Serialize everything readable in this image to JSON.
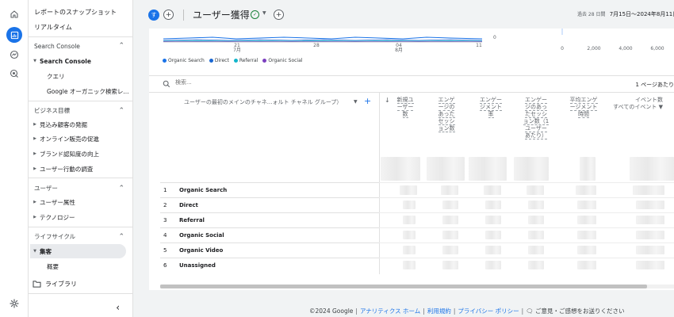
{
  "rail": {
    "items": [
      {
        "name": "home-icon"
      },
      {
        "name": "reports-icon",
        "active": true
      },
      {
        "name": "explore-icon"
      },
      {
        "name": "advertising-icon"
      },
      {
        "name": "settings-icon"
      }
    ]
  },
  "sidebar": {
    "top": [
      "レポートのスナップショット",
      "リアルタイム"
    ],
    "sections": [
      {
        "title": "Search Console",
        "items": [
          {
            "label": "Search Console",
            "bold": true,
            "expanded": true
          }
        ],
        "subitems": [
          "クエリ",
          "Google オーガニック検索レ..."
        ]
      },
      {
        "title": "ビジネス目標",
        "items": [
          {
            "label": "見込み顧客の発掘"
          },
          {
            "label": "オンライン販売の促進"
          },
          {
            "label": "ブランド認知度の向上"
          },
          {
            "label": "ユーザー行動の調査"
          }
        ]
      },
      {
        "title": "ユーザー",
        "items": [
          {
            "label": "ユーザー属性"
          },
          {
            "label": "テクノロジー"
          }
        ]
      },
      {
        "title": "ライフサイクル",
        "items": [
          {
            "label": "集客",
            "bold": true,
            "expanded": true,
            "selected": true
          }
        ],
        "subitems": [
          "概要"
        ]
      }
    ],
    "library": "ライブラリ",
    "collapse_icon": "chevron-left-icon"
  },
  "header": {
    "avatar_letter": "す",
    "title": "ユーザー獲得",
    "date_label": "過去 28 日間",
    "date_range": "7月15日～2024年8月11日"
  },
  "chart_data": {
    "type": "line",
    "x_ticks": [
      {
        "label": "21",
        "sub": "7月"
      },
      {
        "label": "28",
        "sub": ""
      },
      {
        "label": "04",
        "sub": "8月"
      },
      {
        "label": "11",
        "sub": ""
      }
    ],
    "y_tick_right": "0",
    "bar_axis_ticks": [
      "0",
      "2,000",
      "4,000",
      "6,000"
    ],
    "series": [
      {
        "name": "Organic Search",
        "color": "#1a73e8"
      },
      {
        "name": "Direct",
        "color": "#1967d2"
      },
      {
        "name": "Referral",
        "color": "#12b5cb"
      },
      {
        "name": "Organic Social",
        "color": "#7b3fbf"
      }
    ]
  },
  "search": {
    "placeholder": "検索...",
    "page_info": "1 ページあたり"
  },
  "table": {
    "dimension_header": "ユーザーの最初のメインのチャネ...ォルト チャネル グループ）",
    "columns": [
      {
        "label": "新規ユーザー数"
      },
      {
        "label": "エンゲージのあったセッション数"
      },
      {
        "label": "エンゲージメント率"
      },
      {
        "label": "エンゲージのあったセッション数（1 ユーザーあたり）"
      },
      {
        "label": "平均エンゲージメント時間"
      },
      {
        "label": "イベント数",
        "sub": "すべてのイベント"
      }
    ],
    "rows": [
      {
        "num": "1",
        "name": "Organic Search"
      },
      {
        "num": "2",
        "name": "Direct"
      },
      {
        "num": "3",
        "name": "Referral"
      },
      {
        "num": "4",
        "name": "Organic Social"
      },
      {
        "num": "5",
        "name": "Organic Video"
      },
      {
        "num": "6",
        "name": "Unassigned"
      }
    ]
  },
  "footer": {
    "copyright": "©2024 Google",
    "links": [
      "アナリティクス ホーム",
      "利用規約",
      "プライバシー ポリシー"
    ],
    "feedback": "ご意見・ご感想をお送りください"
  }
}
